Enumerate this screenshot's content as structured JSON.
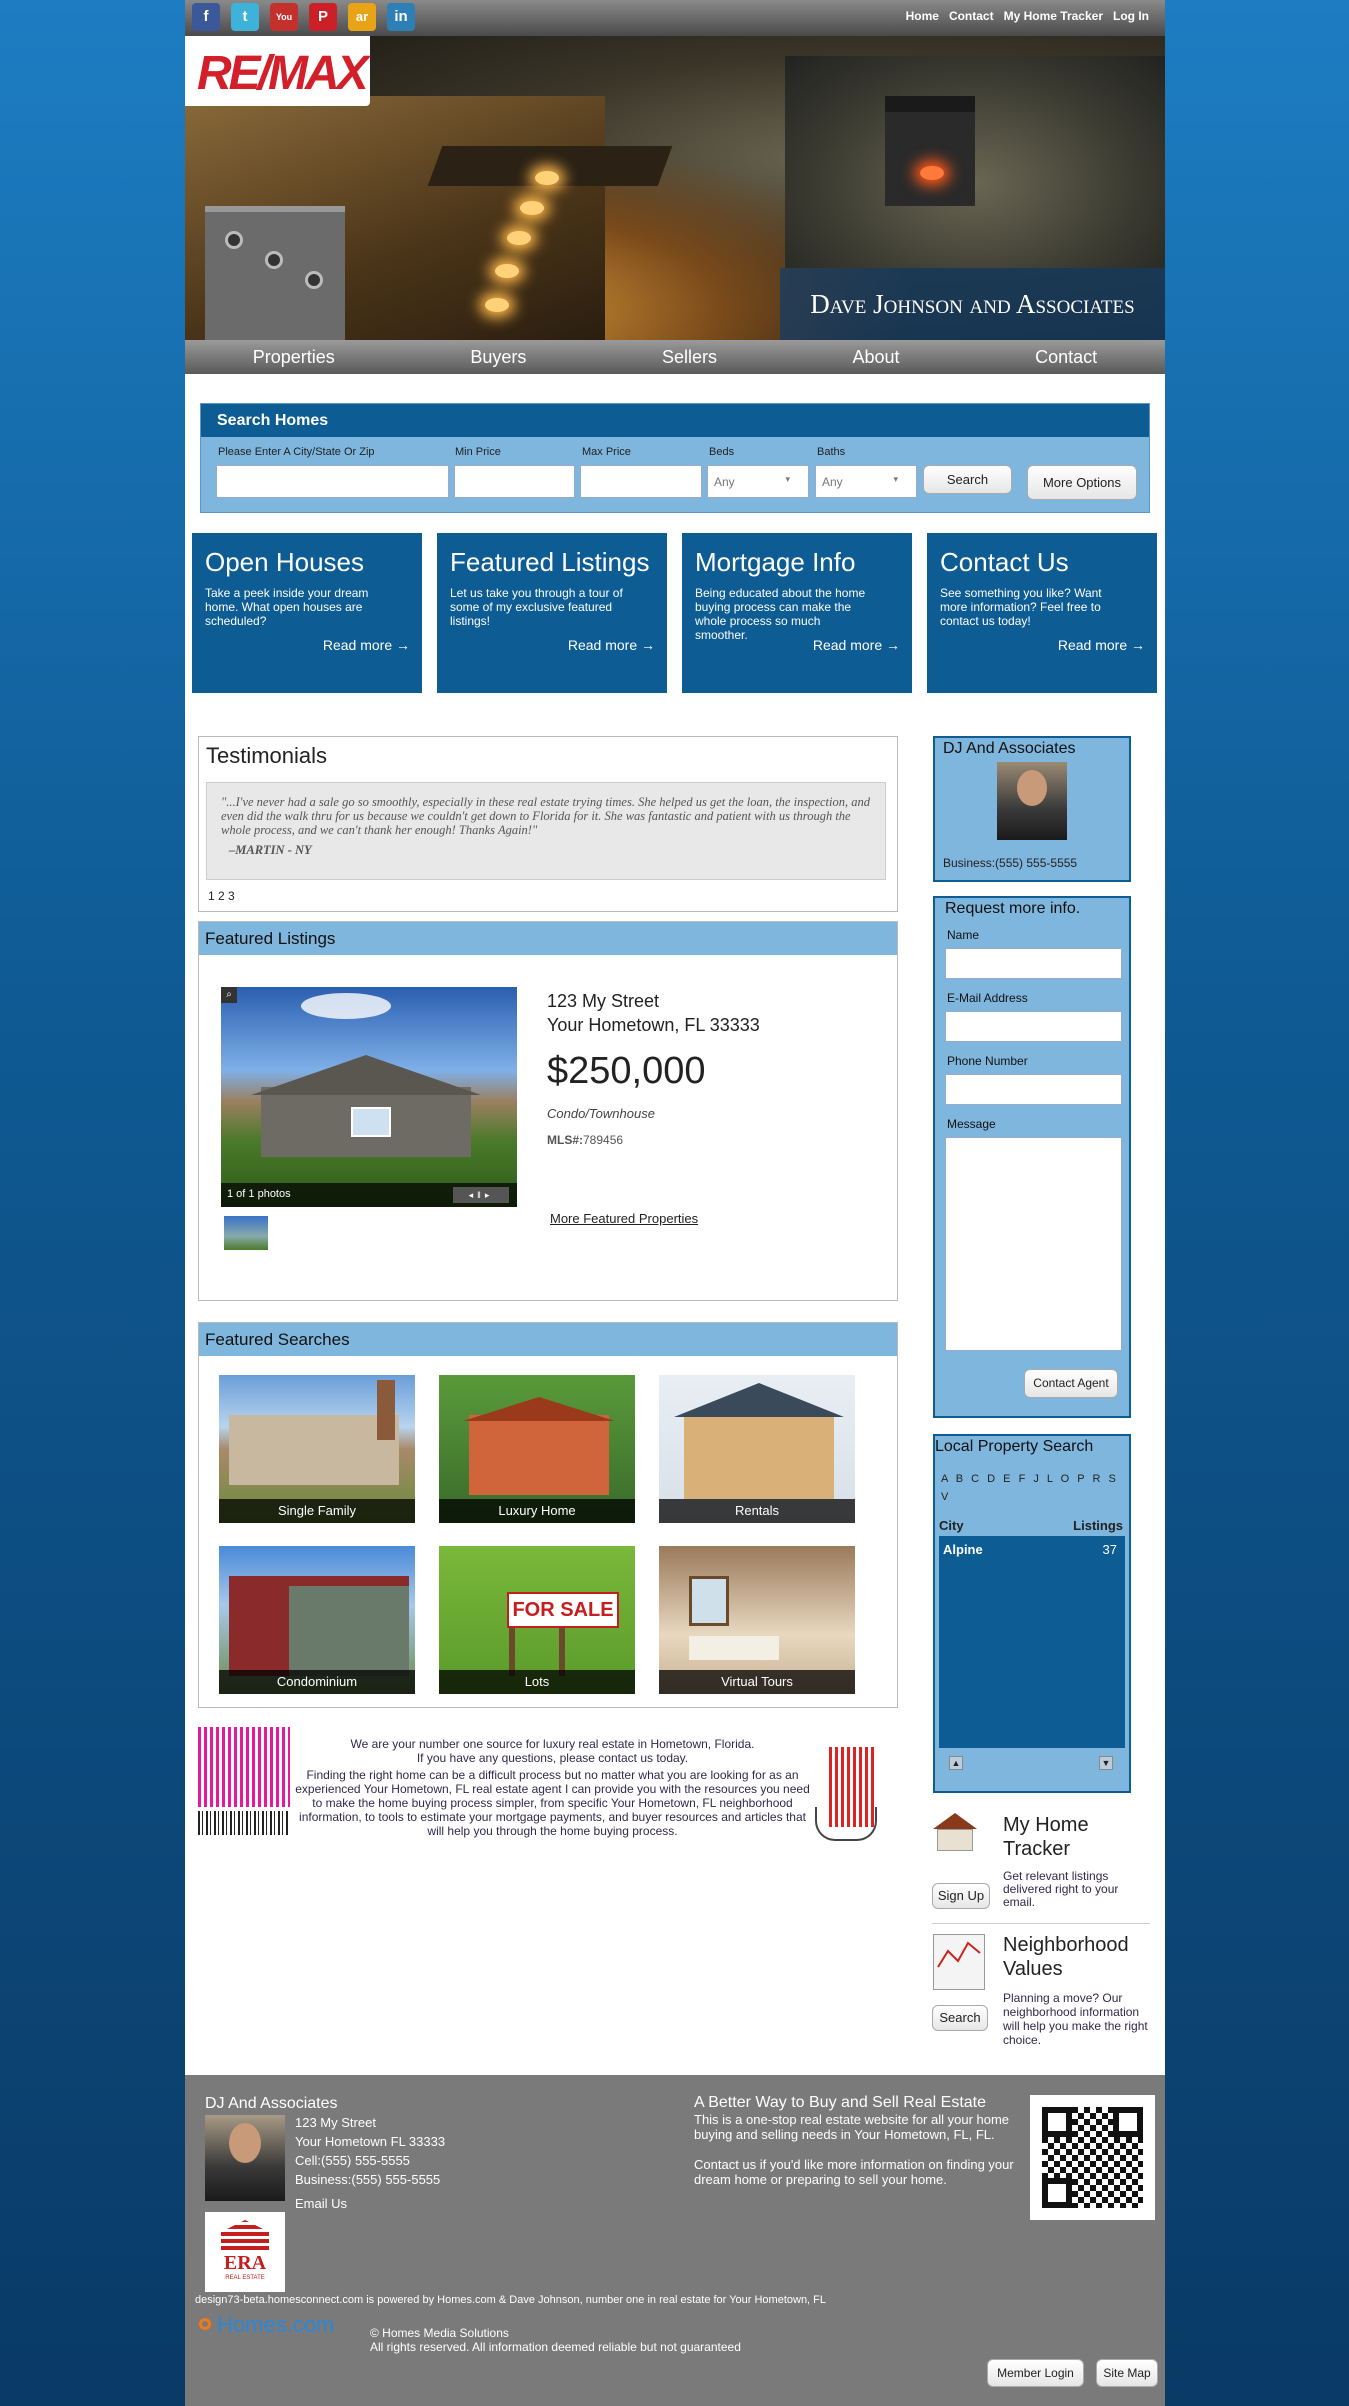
{
  "topbar": {
    "social": [
      {
        "label": "f",
        "icon": "facebook-icon",
        "color": "#3b5998"
      },
      {
        "label": "t",
        "icon": "twitter-icon",
        "color": "#3fb2d9"
      },
      {
        "label": "You",
        "icon": "youtube-icon",
        "color": "#c4302b"
      },
      {
        "label": "P",
        "icon": "pinterest-icon",
        "color": "#cb2027"
      },
      {
        "label": "ar",
        "icon": "activerain-icon",
        "color": "#e8a317"
      },
      {
        "label": "in",
        "icon": "linkedin-icon",
        "color": "#2d7fb6"
      }
    ],
    "nav": [
      "Home",
      "Contact",
      "My Home Tracker",
      "Log In"
    ]
  },
  "hero": {
    "logo_text": "RE/MAX",
    "brand": "Dave Johnson and Associates"
  },
  "mainnav": [
    "Properties",
    "Buyers",
    "Sellers",
    "About",
    "Contact"
  ],
  "search": {
    "title": "Search Homes",
    "labels": {
      "city": "Please Enter A City/State Or Zip",
      "min": "Min Price",
      "max": "Max Price",
      "beds": "Beds",
      "baths": "Baths"
    },
    "beds_value": "Any",
    "baths_value": "Any",
    "search_button": "Search",
    "more_button": "More Options"
  },
  "promos": [
    {
      "title": "Open Houses",
      "desc": "Take a peek inside your dream home. What open houses are scheduled?",
      "more": "Read more →"
    },
    {
      "title": "Featured Listings",
      "desc": "Let us take you through a tour of some of my exclusive featured listings!",
      "more": "Read more →"
    },
    {
      "title": "Mortgage Info",
      "desc": "Being educated about the home buying process can make the whole process so much smoother.",
      "more": "Read more →"
    },
    {
      "title": "Contact Us",
      "desc": "See something you like? Want more information? Feel free to contact us today!",
      "more": "Read more →"
    }
  ],
  "testimonials": {
    "title": "Testimonials",
    "quote": "\"...I've never had a sale go so smoothly, especially in these real estate trying times. She helped us get the loan, the inspection, and even did the walk thru for us because we couldn't get down to Florida for it. She was fantastic and patient with us through the whole process, and we can't thank her enough! Thanks Again!\"",
    "author": "–MARTIN - NY",
    "pages": "1 2 3"
  },
  "featured": {
    "title": "Featured Listings",
    "street": "123 My Street",
    "city": "Your Hometown, FL 33333",
    "price": "$250,000",
    "type": "Condo/Townhouse",
    "mls_label": "MLS#:",
    "mls": "789456",
    "photos": "1 of 1 photos",
    "more": "More Featured Properties"
  },
  "searches": {
    "title": "Featured Searches",
    "tiles": [
      "Single Family",
      "Luxury Home",
      "Rentals",
      "Condominium",
      "Lots",
      "Virtual Tours"
    ],
    "for_sale_sign": "FOR SALE"
  },
  "about": {
    "line1": "We are your number one source for luxury real estate in Hometown, Florida.",
    "line2": "If you have any questions, please contact us today.",
    "para": "Finding the right home can be a difficult process but no matter what you are looking for as an experienced Your Hometown, FL real estate agent I can provide you with the resources you need to make the home buying process simpler, from specific Your Hometown, FL neighborhood information, to tools to estimate your mortgage payments, and buyer resources and articles that will help you through the home buying process."
  },
  "sidebar": {
    "agent_title": "DJ And Associates",
    "business": "Business:(555) 555-5555",
    "request_title": "Request more info.",
    "fields": [
      "Name",
      "E-Mail Address",
      "Phone Number",
      "Message"
    ],
    "contact_button": "Contact Agent",
    "local_title": "Local Property Search",
    "letters": "A B C D E F J L O P R S V",
    "col_city": "City",
    "col_listings": "Listings",
    "city": "Alpine",
    "listings": "37",
    "tracker_title": "My Home Tracker",
    "tracker_desc": "Get relevant listings delivered right to your email.",
    "tracker_button": "Sign Up",
    "nv_title": "Neighborhood Values",
    "nv_desc": "Planning a move? Our neighborhood information will help you make the right choice.",
    "nv_button": "Search"
  },
  "footer": {
    "agent": "DJ And Associates",
    "street": "123 My Street",
    "city": "Your Hometown FL 33333",
    "cell": "Cell:(555) 555-5555",
    "business": "Business:(555) 555-5555",
    "email": "Email Us",
    "era": "ERA",
    "era_sub": "REAL ESTATE",
    "tag_title": "A Better Way to Buy and Sell Real Estate",
    "tag_p1": "This is a one-stop real estate website for all your home buying and selling needs in Your Hometown, FL, FL.",
    "tag_p2": "Contact us if you'd like more information on finding your dream home or preparing to sell your home.",
    "powered": "design73-beta.homesconnect.com is powered by Homes.com & Dave Johnson, number one in real estate for Your Hometown, FL",
    "homes_logo": "Homes.com",
    "copyright": "© Homes Media Solutions",
    "rights": "All rights reserved. All information deemed reliable but not guaranteed",
    "member_login": "Member Login",
    "sitemap": "Site Map"
  }
}
